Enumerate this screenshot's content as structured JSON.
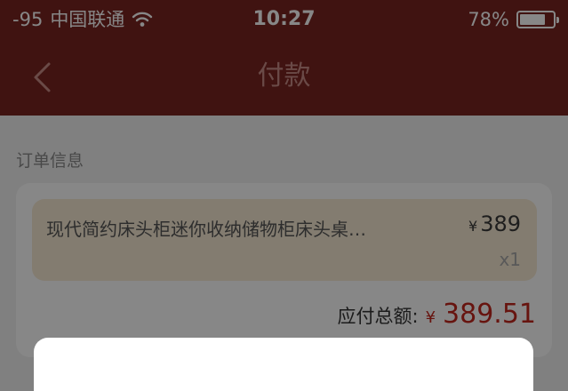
{
  "status_bar": {
    "signal": "-95",
    "carrier": "中国联通",
    "time": "10:27",
    "battery_percent": "78%",
    "battery_level": 0.78
  },
  "nav": {
    "title": "付款"
  },
  "order": {
    "section_title": "订单信息",
    "product": {
      "name": "现代简约床头柜迷你收纳储物柜床头桌…",
      "currency": "¥",
      "price": "389",
      "quantity": "x1"
    },
    "total_label": "应付总额:",
    "total_currency": "¥",
    "total_amount": "389.51"
  },
  "colors": {
    "brand": "#b8312c",
    "price_red": "#c2271d",
    "product_bg": "#f7ead3"
  }
}
